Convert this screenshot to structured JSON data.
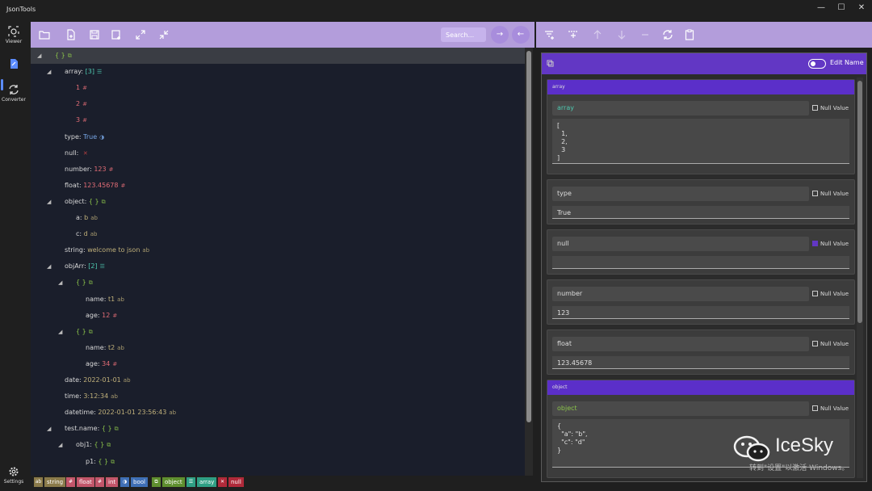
{
  "app": {
    "title": "JsonTools"
  },
  "window": {
    "minimize": "—",
    "maximize": "☐",
    "close": "✕"
  },
  "nav": [
    {
      "label": "Viewer",
      "icon": "viewer-icon"
    },
    {
      "label": "",
      "icon": "file-tree-icon"
    },
    {
      "label": "Converter",
      "icon": "converter-icon"
    },
    {
      "label": "Settings",
      "icon": "gear-icon"
    }
  ],
  "left_toolbar": {
    "search_placeholder": "Search...",
    "next": "→",
    "prev": "←"
  },
  "tree": [
    {
      "indent": 0,
      "arrow": "◢",
      "key": "",
      "value": "{ }",
      "vtype": "obj",
      "icon": "⧉",
      "selected": true
    },
    {
      "indent": 1,
      "arrow": "◢",
      "key": "array:",
      "value": "[3]",
      "vtype": "arr",
      "icon": "☰"
    },
    {
      "indent": 2,
      "arrow": "",
      "key": "",
      "value": "1",
      "vtype": "num",
      "icon": "#"
    },
    {
      "indent": 2,
      "arrow": "",
      "key": "",
      "value": "2",
      "vtype": "num",
      "icon": "#"
    },
    {
      "indent": 2,
      "arrow": "",
      "key": "",
      "value": "3",
      "vtype": "num",
      "icon": "#"
    },
    {
      "indent": 1,
      "arrow": "",
      "key": "type:",
      "value": "True",
      "vtype": "bool",
      "icon": "◑"
    },
    {
      "indent": 1,
      "arrow": "",
      "key": "null:",
      "value": "",
      "vtype": "null",
      "icon": "✕"
    },
    {
      "indent": 1,
      "arrow": "",
      "key": "number:",
      "value": "123",
      "vtype": "num",
      "icon": "#"
    },
    {
      "indent": 1,
      "arrow": "",
      "key": "float:",
      "value": "123.45678",
      "vtype": "num",
      "icon": "#"
    },
    {
      "indent": 1,
      "arrow": "◢",
      "key": "object:",
      "value": "{ }",
      "vtype": "obj",
      "icon": "⧉"
    },
    {
      "indent": 2,
      "arrow": "",
      "key": "a:",
      "value": "b",
      "vtype": "str",
      "icon": "ab"
    },
    {
      "indent": 2,
      "arrow": "",
      "key": "c:",
      "value": "d",
      "vtype": "str",
      "icon": "ab"
    },
    {
      "indent": 1,
      "arrow": "",
      "key": "string:",
      "value": "welcome to json",
      "vtype": "str",
      "icon": "ab"
    },
    {
      "indent": 1,
      "arrow": "◢",
      "key": "objArr:",
      "value": "[2]",
      "vtype": "arr",
      "icon": "☰"
    },
    {
      "indent": 2,
      "arrow": "◢",
      "key": "",
      "value": "{ }",
      "vtype": "obj",
      "icon": "⧉"
    },
    {
      "indent": 3,
      "arrow": "",
      "key": "name:",
      "value": "t1",
      "vtype": "str",
      "icon": "ab"
    },
    {
      "indent": 3,
      "arrow": "",
      "key": "age:",
      "value": "12",
      "vtype": "num",
      "icon": "#"
    },
    {
      "indent": 2,
      "arrow": "◢",
      "key": "",
      "value": "{ }",
      "vtype": "obj",
      "icon": "⧉"
    },
    {
      "indent": 3,
      "arrow": "",
      "key": "name:",
      "value": "t2",
      "vtype": "str",
      "icon": "ab"
    },
    {
      "indent": 3,
      "arrow": "",
      "key": "age:",
      "value": "34",
      "vtype": "num",
      "icon": "#"
    },
    {
      "indent": 1,
      "arrow": "",
      "key": "date:",
      "value": "2022-01-01",
      "vtype": "str",
      "icon": "ab"
    },
    {
      "indent": 1,
      "arrow": "",
      "key": "time:",
      "value": "3:12:34",
      "vtype": "str",
      "icon": "ab"
    },
    {
      "indent": 1,
      "arrow": "",
      "key": "datetime:",
      "value": "2022-01-01 23:56:43",
      "vtype": "str",
      "icon": "ab"
    },
    {
      "indent": 1,
      "arrow": "◢",
      "key": "test.name:",
      "value": "{ }",
      "vtype": "obj",
      "icon": "⧉"
    },
    {
      "indent": 2,
      "arrow": "◢",
      "key": "obj1:",
      "value": "{ }",
      "vtype": "obj",
      "icon": "⧉"
    },
    {
      "indent": 3,
      "arrow": "",
      "key": "p1:",
      "value": "{ }",
      "vtype": "obj",
      "icon": "⧉"
    }
  ],
  "legend": [
    {
      "label": "string",
      "glyph": "ab",
      "color": "#8a7a4a"
    },
    {
      "label": "float",
      "glyph": "#",
      "color": "#c2566a"
    },
    {
      "label": "int",
      "glyph": "#",
      "color": "#c2566a"
    },
    {
      "label": "bool",
      "glyph": "◑",
      "color": "#3f6fb5"
    },
    {
      "label": "object",
      "glyph": "⧉",
      "color": "#5f8f2f"
    },
    {
      "label": "array",
      "glyph": "☰",
      "color": "#2f9f84"
    },
    {
      "label": "null",
      "glyph": "✕",
      "color": "#b02a3a"
    }
  ],
  "editor": {
    "edit_name_label": "Edit Name",
    "null_label": "Null Value",
    "cards": [
      {
        "header": "array",
        "name": "array",
        "name_style": "accent",
        "null": false,
        "value": "[\n  1,\n  2,\n  3\n]"
      },
      {
        "header": "",
        "name": "type",
        "name_style": "",
        "null": false,
        "value": "True"
      },
      {
        "header": "",
        "name": "null",
        "name_style": "",
        "null": true,
        "value": ""
      },
      {
        "header": "",
        "name": "number",
        "name_style": "",
        "null": false,
        "value": "123"
      },
      {
        "header": "",
        "name": "float",
        "name_style": "",
        "null": false,
        "value": "123.45678"
      },
      {
        "header": "object",
        "name": "object",
        "name_style": "green",
        "null": false,
        "value": "{\n  \"a\": \"b\",\n  \"c\": \"d\"\n}"
      }
    ]
  },
  "watermark": {
    "brand": "IceSky",
    "sub": "转到\"设置\"以激活 Windows。"
  },
  "colors": {
    "toolbar": "#b39ddb",
    "accent": "#6237c4",
    "tree_bg": "#1a1e2b"
  }
}
